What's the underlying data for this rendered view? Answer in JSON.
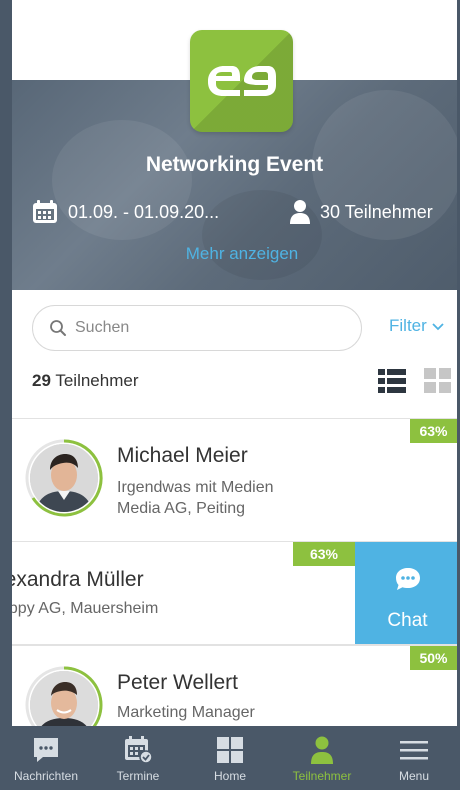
{
  "event": {
    "logo_text": "e9",
    "title": "Networking Event",
    "date_range": "01.09. - 01.09.20...",
    "participants_total": "30 Teilnehmer",
    "more_link": "Mehr anzeigen"
  },
  "search": {
    "placeholder": "Suchen"
  },
  "filter": {
    "label": "Filter"
  },
  "list_header": {
    "count": "29",
    "count_label": " Teilnehmer"
  },
  "participants": [
    {
      "name": "Michael Meier",
      "line1": "Irgendwas mit Medien",
      "line2": "Media AG, Peiting",
      "match": "63%"
    },
    {
      "name": "lexandra Müller",
      "line1": "appy AG, Mauersheim",
      "match": "63%"
    },
    {
      "name": "Peter Wellert",
      "line1": "Marketing Manager",
      "match": "50%"
    }
  ],
  "chat_action": {
    "label": "Chat"
  },
  "nav": {
    "items": [
      {
        "label": "Nachrichten",
        "icon": "chat-bubble-icon"
      },
      {
        "label": "Termine",
        "icon": "calendar-icon"
      },
      {
        "label": "Home",
        "icon": "grid-icon"
      },
      {
        "label": "Teilnehmer",
        "icon": "person-icon"
      },
      {
        "label": "Menu",
        "icon": "hamburger-icon"
      }
    ]
  },
  "colors": {
    "brand_green": "#8dc13f",
    "accent_blue": "#4fb3e3",
    "nav_bg": "#4a5868"
  }
}
